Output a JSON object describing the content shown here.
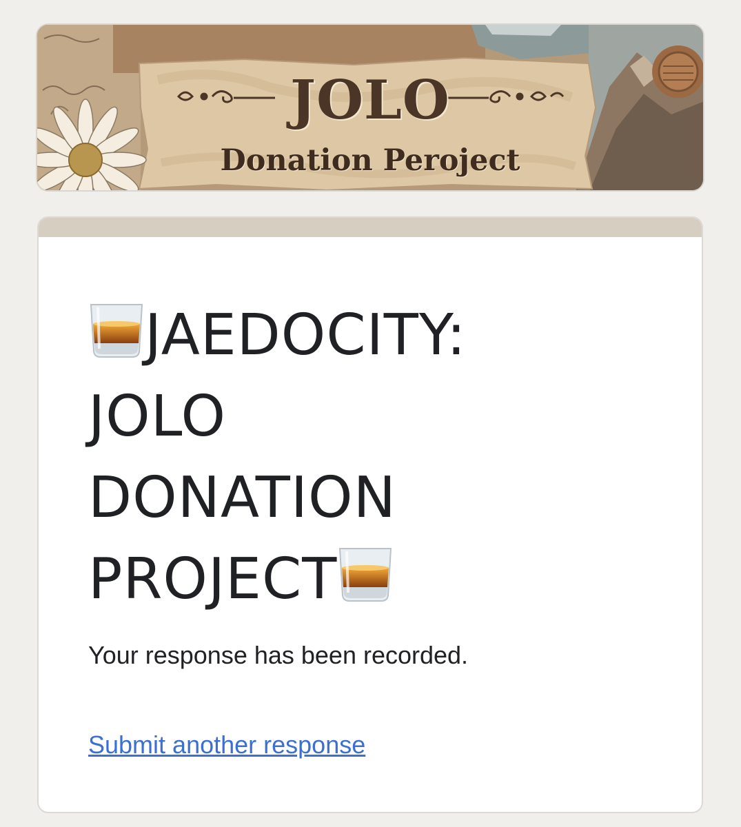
{
  "banner": {
    "title": "JOLO",
    "subtitle": "Donation Perojec​t"
  },
  "form": {
    "title_lines": [
      "JAEDOCITY:",
      "JOLO",
      "DONATION",
      "PROJECT"
    ],
    "title_icon": "tumbler-glass-icon",
    "confirmation": "Your response has been recorded.",
    "submit_another_label": "Submit another response"
  },
  "colors": {
    "page_background": "#f1efec",
    "card_accent": "#d6cfc1",
    "link": "#3b6fd1",
    "banner_text": "#4a3526"
  }
}
